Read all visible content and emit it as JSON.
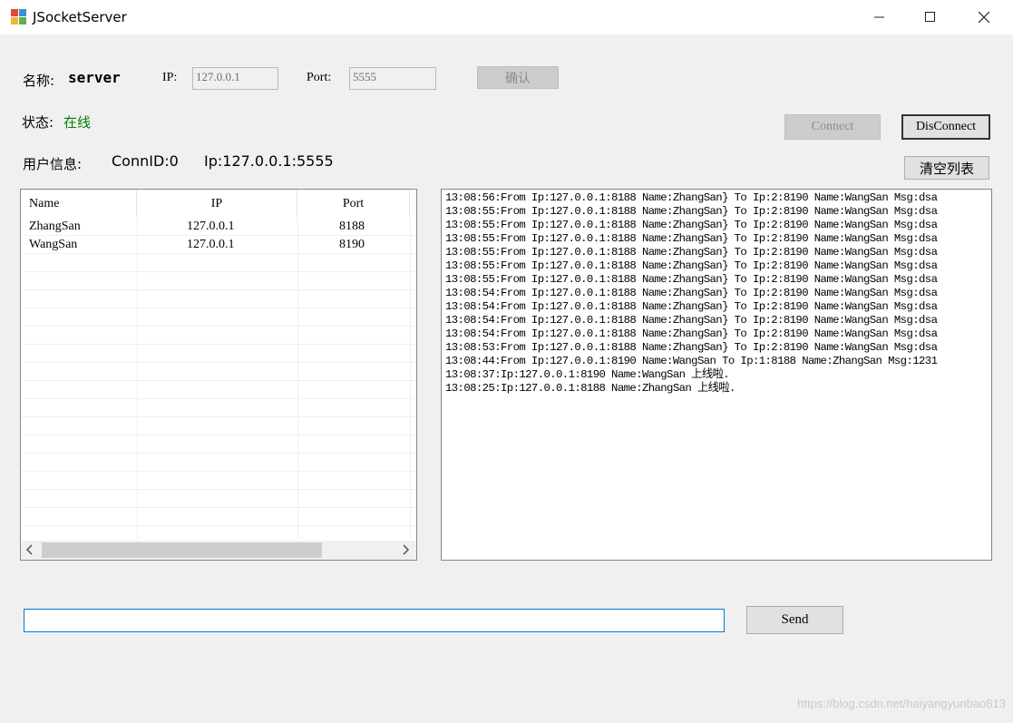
{
  "window": {
    "title": "JSocketServer",
    "minimize": "—",
    "maximize": "☐",
    "close": "✕"
  },
  "config": {
    "name_label": "名称:",
    "name_value": "server",
    "ip_label": "IP:",
    "ip_value": "127.0.0.1",
    "port_label": "Port:",
    "port_value": "5555",
    "confirm_button": "确认"
  },
  "status": {
    "label": "状态:",
    "value": "在线",
    "color": "#008000"
  },
  "buttons": {
    "connect": "Connect",
    "disconnect": "DisConnect",
    "clear_list": "清空列表",
    "send": "Send"
  },
  "user_info": {
    "label": "用户信息:",
    "conn_id": "ConnID:0",
    "ip": "Ip:127.0.0.1:5555"
  },
  "clients": {
    "columns": [
      "Name",
      "IP",
      "Port"
    ],
    "rows": [
      {
        "name": "ZhangSan",
        "ip": "127.0.0.1",
        "port": "8188"
      },
      {
        "name": "WangSan",
        "ip": "127.0.0.1",
        "port": "8190"
      }
    ]
  },
  "log": [
    "13:08:56:From Ip:127.0.0.1:8188 Name:ZhangSan} To Ip:2:8190 Name:WangSan Msg:dsa",
    "13:08:55:From Ip:127.0.0.1:8188 Name:ZhangSan} To Ip:2:8190 Name:WangSan Msg:dsa",
    "13:08:55:From Ip:127.0.0.1:8188 Name:ZhangSan} To Ip:2:8190 Name:WangSan Msg:dsa",
    "13:08:55:From Ip:127.0.0.1:8188 Name:ZhangSan} To Ip:2:8190 Name:WangSan Msg:dsa",
    "13:08:55:From Ip:127.0.0.1:8188 Name:ZhangSan} To Ip:2:8190 Name:WangSan Msg:dsa",
    "13:08:55:From Ip:127.0.0.1:8188 Name:ZhangSan} To Ip:2:8190 Name:WangSan Msg:dsa",
    "13:08:55:From Ip:127.0.0.1:8188 Name:ZhangSan} To Ip:2:8190 Name:WangSan Msg:dsa",
    "13:08:54:From Ip:127.0.0.1:8188 Name:ZhangSan} To Ip:2:8190 Name:WangSan Msg:dsa",
    "13:08:54:From Ip:127.0.0.1:8188 Name:ZhangSan} To Ip:2:8190 Name:WangSan Msg:dsa",
    "13:08:54:From Ip:127.0.0.1:8188 Name:ZhangSan} To Ip:2:8190 Name:WangSan Msg:dsa",
    "13:08:54:From Ip:127.0.0.1:8188 Name:ZhangSan} To Ip:2:8190 Name:WangSan Msg:dsa",
    "13:08:53:From Ip:127.0.0.1:8188 Name:ZhangSan} To Ip:2:8190 Name:WangSan Msg:dsa",
    "13:08:44:From Ip:127.0.0.1:8190 Name:WangSan To Ip:1:8188 Name:ZhangSan Msg:1231",
    "13:08:37:Ip:127.0.0.1:8190 Name:WangSan 上线啦.",
    "13:08:25:Ip:127.0.0.1:8188 Name:ZhangSan 上线啦."
  ],
  "message_input": {
    "value": ""
  },
  "watermark": "https://blog.csdn.net/haiyangyunbao813"
}
